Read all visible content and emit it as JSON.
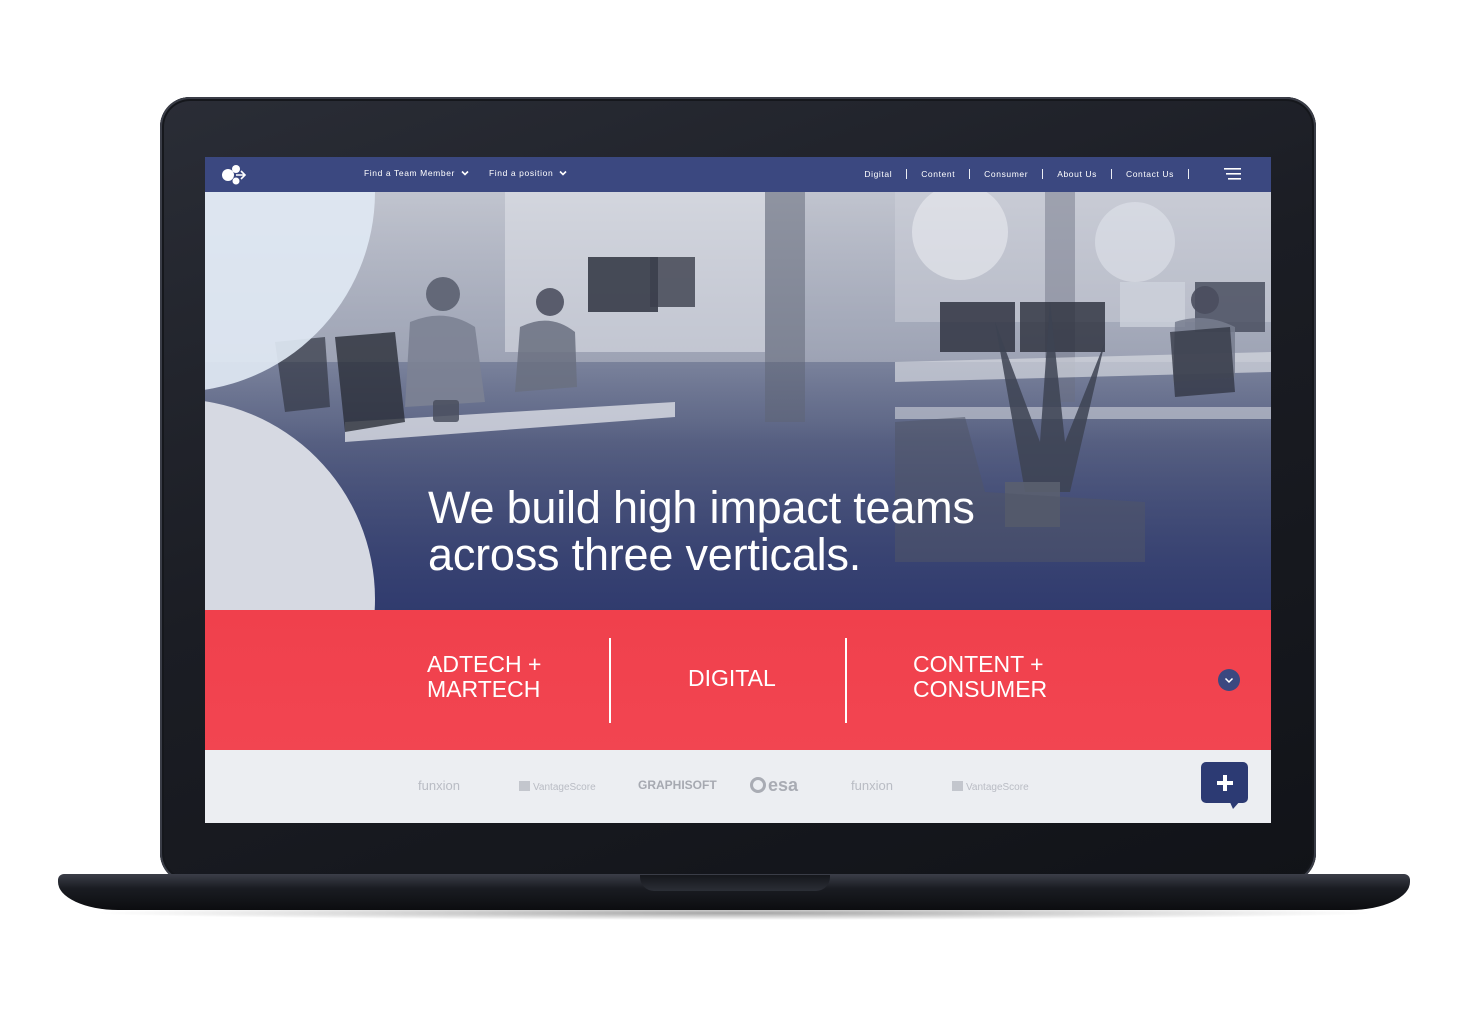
{
  "nav": {
    "dropdowns": [
      {
        "label": "Find a Team Member"
      },
      {
        "label": "Find a position"
      }
    ],
    "links": [
      {
        "label": "Digital"
      },
      {
        "label": "Content"
      },
      {
        "label": "Consumer"
      },
      {
        "label": "About Us"
      },
      {
        "label": "Contact Us"
      }
    ],
    "menu_icon": "hamburger-menu-icon",
    "logo_icon": "brand-logo-icon"
  },
  "hero": {
    "headline_line1": "We build high impact teams",
    "headline_line2": "across three verticals."
  },
  "verticals": {
    "items": [
      {
        "line1": "ADTECH +",
        "line2": "MARTECH"
      },
      {
        "line1": "DIGITAL",
        "line2": ""
      },
      {
        "line1": "CONTENT +",
        "line2": "CONSUMER"
      }
    ],
    "scroll_icon": "chevron-down-icon"
  },
  "clients": {
    "logos": [
      "funxion",
      "VantageScore",
      "GRAPHISOFT",
      "esa",
      "funxion",
      "VantageScore"
    ]
  },
  "chat": {
    "icon": "plus-chat-icon"
  },
  "colors": {
    "nav": "#3b4880",
    "accent_red": "#f0404c",
    "hero_overlay": "#2f3a6e",
    "logos_bg": "#eceef2",
    "chat_button": "#2c3a73"
  }
}
